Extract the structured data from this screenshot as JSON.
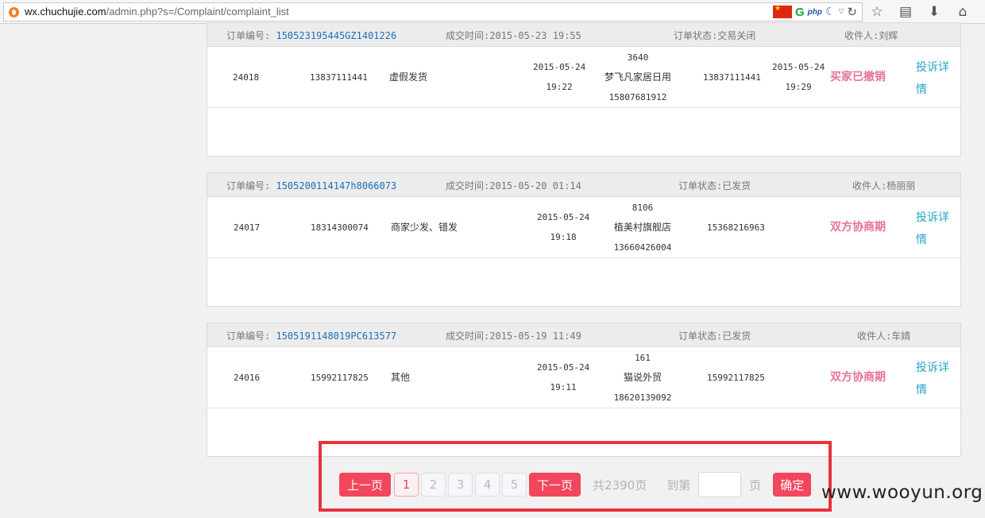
{
  "browser": {
    "url_host": "wx.chuchujie.com",
    "url_path": "/admin.php?s=/Complaint/complaint_list",
    "flag": "china-flag",
    "extensions": [
      "G",
      "php"
    ]
  },
  "labels": {
    "order_no": "订单编号:",
    "deal_time": "成交时间:",
    "order_status": "订单状态:",
    "receiver": "收件人:"
  },
  "orders": [
    {
      "order_no": "150523195445GZ1401226",
      "deal_time": "2015-05-23 19:55",
      "status": "交易关闭",
      "receiver": "刘辉",
      "id": "24018",
      "phone": "13837111441",
      "reason": "虚假发货",
      "created_date": "2015-05-24",
      "created_time": "19:22",
      "shop_id": "3640",
      "shop_name": "梦飞凡家居日用",
      "shop_phone": "15807681912",
      "buyer_phone": "13837111441",
      "handled_date": "2015-05-24",
      "handled_time": "19:29",
      "result": "买家已撤销",
      "detail": "投诉详情"
    },
    {
      "order_no": "1505200114147h8066073",
      "deal_time": "2015-05-20 01:14",
      "status": "已发货",
      "receiver": "杨丽丽",
      "id": "24017",
      "phone": "18314300074",
      "reason": "商家少发、错发",
      "created_date": "2015-05-24",
      "created_time": "19:18",
      "shop_id": "8106",
      "shop_name": "植美村旗舰店",
      "shop_phone": "13660426004",
      "buyer_phone": "15368216963",
      "handled_date": "",
      "handled_time": "",
      "result": "双方协商期",
      "detail": "投诉详情"
    },
    {
      "order_no": "1505191148019PC613577",
      "deal_time": "2015-05-19 11:49",
      "status": "已发货",
      "receiver": "车婧",
      "id": "24016",
      "phone": "15992117825",
      "reason": "其他",
      "created_date": "2015-05-24",
      "created_time": "19:11",
      "shop_id": "161",
      "shop_name": "猫说外贸",
      "shop_phone": "18620139092",
      "buyer_phone": "15992117825",
      "handled_date": "",
      "handled_time": "",
      "result": "双方协商期",
      "detail": "投诉详情"
    }
  ],
  "pagination": {
    "prev": "上一页",
    "pages": [
      "1",
      "2",
      "3",
      "4",
      "5"
    ],
    "current_page": "1",
    "next": "下一页",
    "total": "共2390页",
    "goto_prefix": "到第",
    "goto_suffix": "页",
    "goto_value": "",
    "confirm": "确定"
  },
  "colors": {
    "accent_red": "#f2465c",
    "link_blue": "#1d6fb8",
    "result_pink": "#e8719a",
    "detail_cyan": "#24a5c4",
    "highlight_red": "#e8333a"
  },
  "watermark": "www.wooyun.org"
}
